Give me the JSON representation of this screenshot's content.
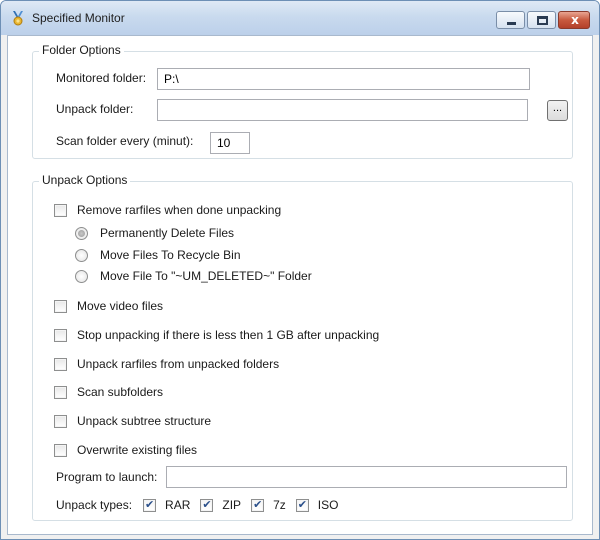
{
  "window": {
    "title": "Specified Monitor",
    "close_glyph": "x"
  },
  "folder_options": {
    "legend": "Folder Options",
    "monitored_label": "Monitored folder:",
    "monitored_value": "P:\\",
    "unpack_label": "Unpack folder:",
    "unpack_value": "",
    "browse_label": "...",
    "scan_label": "Scan folder every (minut):",
    "scan_value": "10"
  },
  "unpack_options": {
    "legend": "Unpack Options",
    "remove_rarfiles": {
      "label": "Remove rarfiles when done unpacking",
      "checked": false
    },
    "delete_modes": [
      {
        "label": "Permanently Delete Files",
        "selected": true
      },
      {
        "label": "Move Files To Recycle Bin",
        "selected": false
      },
      {
        "label": "Move File To \"~UM_DELETED~\" Folder",
        "selected": false
      }
    ],
    "options": [
      {
        "label": "Move video files",
        "checked": false
      },
      {
        "label": "Stop unpacking if there is less then 1 GB after unpacking",
        "checked": false
      },
      {
        "label": "Unpack rarfiles from unpacked folders",
        "checked": false
      },
      {
        "label": "Scan subfolders",
        "checked": false
      },
      {
        "label": "Unpack subtree structure",
        "checked": false
      },
      {
        "label": "Overwrite existing files",
        "checked": false
      }
    ],
    "program_label": "Program to launch:",
    "program_value": "",
    "types_label": "Unpack types:",
    "types": [
      {
        "label": "RAR",
        "checked": true
      },
      {
        "label": "ZIP",
        "checked": true
      },
      {
        "label": "7z",
        "checked": true
      },
      {
        "label": "ISO",
        "checked": true
      }
    ]
  }
}
